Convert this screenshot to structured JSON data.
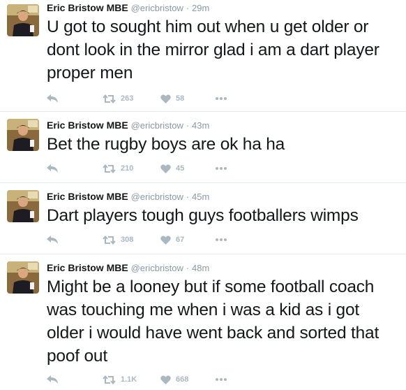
{
  "tweets": [
    {
      "name": "Eric Bristow MBE",
      "handle": "@ericbristow",
      "separator": "·",
      "time": "29m",
      "text": "U got to sought him out when u get older or dont look in the mirror glad i am a dart player proper men",
      "retweets": "263",
      "likes": "58"
    },
    {
      "name": "Eric Bristow MBE",
      "handle": "@ericbristow",
      "separator": "·",
      "time": "43m",
      "text": "Bet the rugby boys are ok ha ha",
      "retweets": "210",
      "likes": "45"
    },
    {
      "name": "Eric Bristow MBE",
      "handle": "@ericbristow",
      "separator": "·",
      "time": "45m",
      "text": "Dart players tough guys footballers wimps",
      "retweets": "308",
      "likes": "67"
    },
    {
      "name": "Eric Bristow MBE",
      "handle": "@ericbristow",
      "separator": "·",
      "time": "48m",
      "text": "Might be a looney but if some football coach was touching me when i was a kid as i got older i would have went back and sorted that poof out",
      "retweets": "1.1K",
      "likes": "668"
    }
  ],
  "icons": {
    "reply": "reply-icon",
    "retweet": "retweet-icon",
    "like": "heart-icon",
    "more": "more-icon"
  },
  "colors": {
    "text": "#14171a",
    "muted": "#8899a6",
    "action": "#aab8c2",
    "divider": "#e6ecf0"
  }
}
